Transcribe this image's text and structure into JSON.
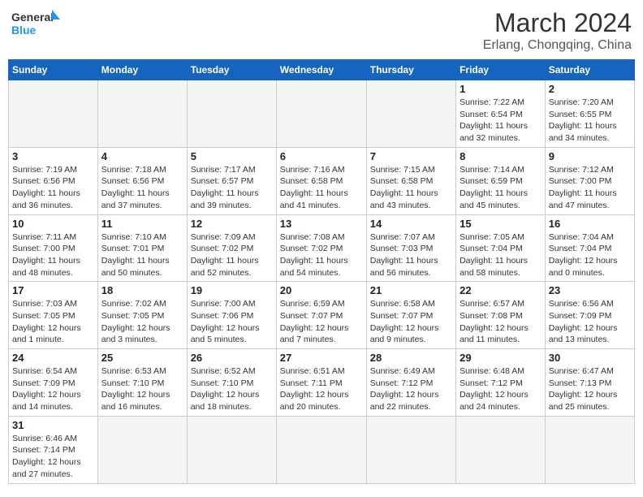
{
  "header": {
    "title": "March 2024",
    "subtitle": "Erlang, Chongqing, China",
    "logo_general": "General",
    "logo_blue": "Blue"
  },
  "days_of_week": [
    "Sunday",
    "Monday",
    "Tuesday",
    "Wednesday",
    "Thursday",
    "Friday",
    "Saturday"
  ],
  "weeks": [
    [
      {
        "day": "",
        "info": "",
        "empty": true
      },
      {
        "day": "",
        "info": "",
        "empty": true
      },
      {
        "day": "",
        "info": "",
        "empty": true
      },
      {
        "day": "",
        "info": "",
        "empty": true
      },
      {
        "day": "",
        "info": "",
        "empty": true
      },
      {
        "day": "1",
        "info": "Sunrise: 7:22 AM\nSunset: 6:54 PM\nDaylight: 11 hours and 32 minutes."
      },
      {
        "day": "2",
        "info": "Sunrise: 7:20 AM\nSunset: 6:55 PM\nDaylight: 11 hours and 34 minutes."
      }
    ],
    [
      {
        "day": "3",
        "info": "Sunrise: 7:19 AM\nSunset: 6:56 PM\nDaylight: 11 hours and 36 minutes."
      },
      {
        "day": "4",
        "info": "Sunrise: 7:18 AM\nSunset: 6:56 PM\nDaylight: 11 hours and 37 minutes."
      },
      {
        "day": "5",
        "info": "Sunrise: 7:17 AM\nSunset: 6:57 PM\nDaylight: 11 hours and 39 minutes."
      },
      {
        "day": "6",
        "info": "Sunrise: 7:16 AM\nSunset: 6:58 PM\nDaylight: 11 hours and 41 minutes."
      },
      {
        "day": "7",
        "info": "Sunrise: 7:15 AM\nSunset: 6:58 PM\nDaylight: 11 hours and 43 minutes."
      },
      {
        "day": "8",
        "info": "Sunrise: 7:14 AM\nSunset: 6:59 PM\nDaylight: 11 hours and 45 minutes."
      },
      {
        "day": "9",
        "info": "Sunrise: 7:12 AM\nSunset: 7:00 PM\nDaylight: 11 hours and 47 minutes."
      }
    ],
    [
      {
        "day": "10",
        "info": "Sunrise: 7:11 AM\nSunset: 7:00 PM\nDaylight: 11 hours and 48 minutes."
      },
      {
        "day": "11",
        "info": "Sunrise: 7:10 AM\nSunset: 7:01 PM\nDaylight: 11 hours and 50 minutes."
      },
      {
        "day": "12",
        "info": "Sunrise: 7:09 AM\nSunset: 7:02 PM\nDaylight: 11 hours and 52 minutes."
      },
      {
        "day": "13",
        "info": "Sunrise: 7:08 AM\nSunset: 7:02 PM\nDaylight: 11 hours and 54 minutes."
      },
      {
        "day": "14",
        "info": "Sunrise: 7:07 AM\nSunset: 7:03 PM\nDaylight: 11 hours and 56 minutes."
      },
      {
        "day": "15",
        "info": "Sunrise: 7:05 AM\nSunset: 7:04 PM\nDaylight: 11 hours and 58 minutes."
      },
      {
        "day": "16",
        "info": "Sunrise: 7:04 AM\nSunset: 7:04 PM\nDaylight: 12 hours and 0 minutes."
      }
    ],
    [
      {
        "day": "17",
        "info": "Sunrise: 7:03 AM\nSunset: 7:05 PM\nDaylight: 12 hours and 1 minute."
      },
      {
        "day": "18",
        "info": "Sunrise: 7:02 AM\nSunset: 7:05 PM\nDaylight: 12 hours and 3 minutes."
      },
      {
        "day": "19",
        "info": "Sunrise: 7:00 AM\nSunset: 7:06 PM\nDaylight: 12 hours and 5 minutes."
      },
      {
        "day": "20",
        "info": "Sunrise: 6:59 AM\nSunset: 7:07 PM\nDaylight: 12 hours and 7 minutes."
      },
      {
        "day": "21",
        "info": "Sunrise: 6:58 AM\nSunset: 7:07 PM\nDaylight: 12 hours and 9 minutes."
      },
      {
        "day": "22",
        "info": "Sunrise: 6:57 AM\nSunset: 7:08 PM\nDaylight: 12 hours and 11 minutes."
      },
      {
        "day": "23",
        "info": "Sunrise: 6:56 AM\nSunset: 7:09 PM\nDaylight: 12 hours and 13 minutes."
      }
    ],
    [
      {
        "day": "24",
        "info": "Sunrise: 6:54 AM\nSunset: 7:09 PM\nDaylight: 12 hours and 14 minutes."
      },
      {
        "day": "25",
        "info": "Sunrise: 6:53 AM\nSunset: 7:10 PM\nDaylight: 12 hours and 16 minutes."
      },
      {
        "day": "26",
        "info": "Sunrise: 6:52 AM\nSunset: 7:10 PM\nDaylight: 12 hours and 18 minutes."
      },
      {
        "day": "27",
        "info": "Sunrise: 6:51 AM\nSunset: 7:11 PM\nDaylight: 12 hours and 20 minutes."
      },
      {
        "day": "28",
        "info": "Sunrise: 6:49 AM\nSunset: 7:12 PM\nDaylight: 12 hours and 22 minutes."
      },
      {
        "day": "29",
        "info": "Sunrise: 6:48 AM\nSunset: 7:12 PM\nDaylight: 12 hours and 24 minutes."
      },
      {
        "day": "30",
        "info": "Sunrise: 6:47 AM\nSunset: 7:13 PM\nDaylight: 12 hours and 25 minutes."
      }
    ],
    [
      {
        "day": "31",
        "info": "Sunrise: 6:46 AM\nSunset: 7:14 PM\nDaylight: 12 hours and 27 minutes."
      },
      {
        "day": "",
        "info": "",
        "empty": true
      },
      {
        "day": "",
        "info": "",
        "empty": true
      },
      {
        "day": "",
        "info": "",
        "empty": true
      },
      {
        "day": "",
        "info": "",
        "empty": true
      },
      {
        "day": "",
        "info": "",
        "empty": true
      },
      {
        "day": "",
        "info": "",
        "empty": true
      }
    ]
  ]
}
